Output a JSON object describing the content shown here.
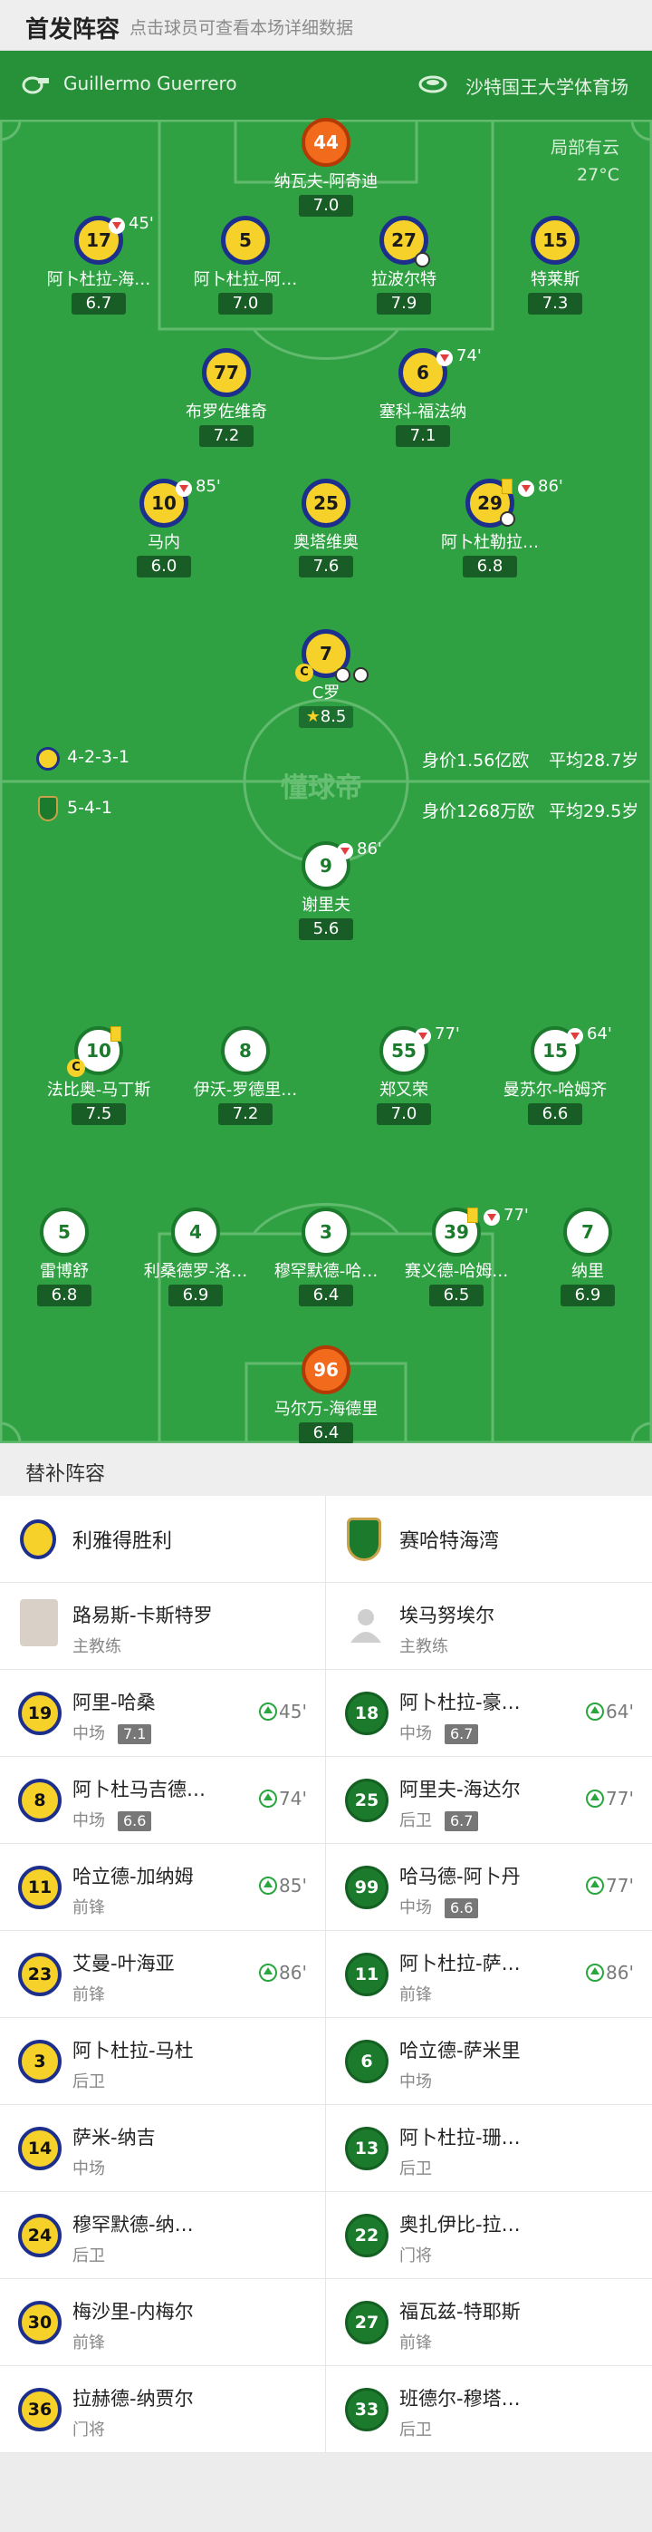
{
  "header": {
    "title": "首发阵容",
    "subtitle": "点击球员可查看本场详细数据"
  },
  "info": {
    "referee": "Guillermo Guerrero",
    "venue": "沙特国王大学体育场"
  },
  "weather": {
    "condition": "局部有云",
    "temp": "27°C"
  },
  "teams": {
    "home": {
      "formation": "4-2-3-1",
      "value": "身价1.56亿欧",
      "age": "平均28.7岁"
    },
    "away": {
      "formation": "5-4-1",
      "value": "身价1268万欧",
      "age": "平均29.5岁"
    }
  },
  "watermark": "懂球帝",
  "home_players": [
    {
      "num": "44",
      "name": "纳瓦夫-阿奇迪",
      "rating": "7.0"
    },
    {
      "num": "17",
      "name": "阿卜杜拉-海…",
      "rating": "6.7",
      "sub": "45'"
    },
    {
      "num": "5",
      "name": "阿卜杜拉-阿…",
      "rating": "7.0"
    },
    {
      "num": "27",
      "name": "拉波尔特",
      "rating": "7.9"
    },
    {
      "num": "15",
      "name": "特莱斯",
      "rating": "7.3"
    },
    {
      "num": "77",
      "name": "布罗佐维奇",
      "rating": "7.2"
    },
    {
      "num": "6",
      "name": "塞科-福法纳",
      "rating": "7.1",
      "sub": "74'"
    },
    {
      "num": "10",
      "name": "马内",
      "rating": "6.0",
      "sub": "85'"
    },
    {
      "num": "25",
      "name": "奥塔维奥",
      "rating": "7.6"
    },
    {
      "num": "29",
      "name": "阿卜杜勒拉…",
      "rating": "6.8",
      "sub": "86'"
    },
    {
      "num": "7",
      "name": "C罗",
      "rating": "8.5"
    }
  ],
  "away_players": [
    {
      "num": "9",
      "name": "谢里夫",
      "rating": "5.6",
      "sub": "86'"
    },
    {
      "num": "10",
      "name": "法比奥-马丁斯",
      "rating": "7.5"
    },
    {
      "num": "8",
      "name": "伊沃-罗德里…",
      "rating": "7.2"
    },
    {
      "num": "55",
      "name": "郑又荣",
      "rating": "7.0",
      "sub": "77'"
    },
    {
      "num": "15",
      "name": "曼苏尔-哈姆齐",
      "rating": "6.6",
      "sub": "64'"
    },
    {
      "num": "5",
      "name": "雷博舒",
      "rating": "6.8"
    },
    {
      "num": "4",
      "name": "利桑德罗-洛…",
      "rating": "6.9"
    },
    {
      "num": "3",
      "name": "穆罕默德-哈…",
      "rating": "6.4"
    },
    {
      "num": "39",
      "name": "赛义德-哈姆…",
      "rating": "6.5",
      "sub": "77'"
    },
    {
      "num": "7",
      "name": "纳里",
      "rating": "6.9"
    },
    {
      "num": "96",
      "name": "马尔万-海德里",
      "rating": "6.4"
    }
  ],
  "subs_title": "替补阵容",
  "subs": {
    "home_team": "利雅得胜利",
    "away_team": "赛哈特海湾",
    "home_coach": {
      "name": "路易斯-卡斯特罗",
      "role": "主教练"
    },
    "away_coach": {
      "name": "埃马努埃尔",
      "role": "主教练"
    },
    "home": [
      {
        "num": "19",
        "name": "阿里-哈桑",
        "pos": "中场",
        "rating": "7.1",
        "in": "45'"
      },
      {
        "num": "8",
        "name": "阿卜杜马吉德…",
        "pos": "中场",
        "rating": "6.6",
        "in": "74'"
      },
      {
        "num": "11",
        "name": "哈立德-加纳姆",
        "pos": "前锋",
        "rating": "",
        "in": "85'"
      },
      {
        "num": "23",
        "name": "艾曼-叶海亚",
        "pos": "前锋",
        "rating": "",
        "in": "86'"
      },
      {
        "num": "3",
        "name": "阿卜杜拉-马杜",
        "pos": "后卫",
        "rating": "",
        "in": ""
      },
      {
        "num": "14",
        "name": "萨米-纳吉",
        "pos": "中场",
        "rating": "",
        "in": ""
      },
      {
        "num": "24",
        "name": "穆罕默德-纳…",
        "pos": "后卫",
        "rating": "",
        "in": ""
      },
      {
        "num": "30",
        "name": "梅沙里-内梅尔",
        "pos": "前锋",
        "rating": "",
        "in": ""
      },
      {
        "num": "36",
        "name": "拉赫德-纳贾尔",
        "pos": "门将",
        "rating": "",
        "in": ""
      }
    ],
    "away": [
      {
        "num": "18",
        "name": "阿卜杜拉-豪…",
        "pos": "中场",
        "rating": "6.7",
        "in": "64'"
      },
      {
        "num": "25",
        "name": "阿里夫-海达尔",
        "pos": "后卫",
        "rating": "6.7",
        "in": "77'"
      },
      {
        "num": "99",
        "name": "哈马德-阿卜丹",
        "pos": "中场",
        "rating": "6.6",
        "in": "77'"
      },
      {
        "num": "11",
        "name": "阿卜杜拉-萨…",
        "pos": "前锋",
        "rating": "",
        "in": "86'"
      },
      {
        "num": "6",
        "name": "哈立德-萨米里",
        "pos": "中场",
        "rating": "",
        "in": ""
      },
      {
        "num": "13",
        "name": "阿卜杜拉-珊…",
        "pos": "后卫",
        "rating": "",
        "in": ""
      },
      {
        "num": "22",
        "name": "奥扎伊比-拉…",
        "pos": "门将",
        "rating": "",
        "in": ""
      },
      {
        "num": "27",
        "name": "福瓦兹-特耶斯",
        "pos": "前锋",
        "rating": "",
        "in": ""
      },
      {
        "num": "33",
        "name": "班德尔-穆塔…",
        "pos": "后卫",
        "rating": "",
        "in": ""
      }
    ]
  }
}
